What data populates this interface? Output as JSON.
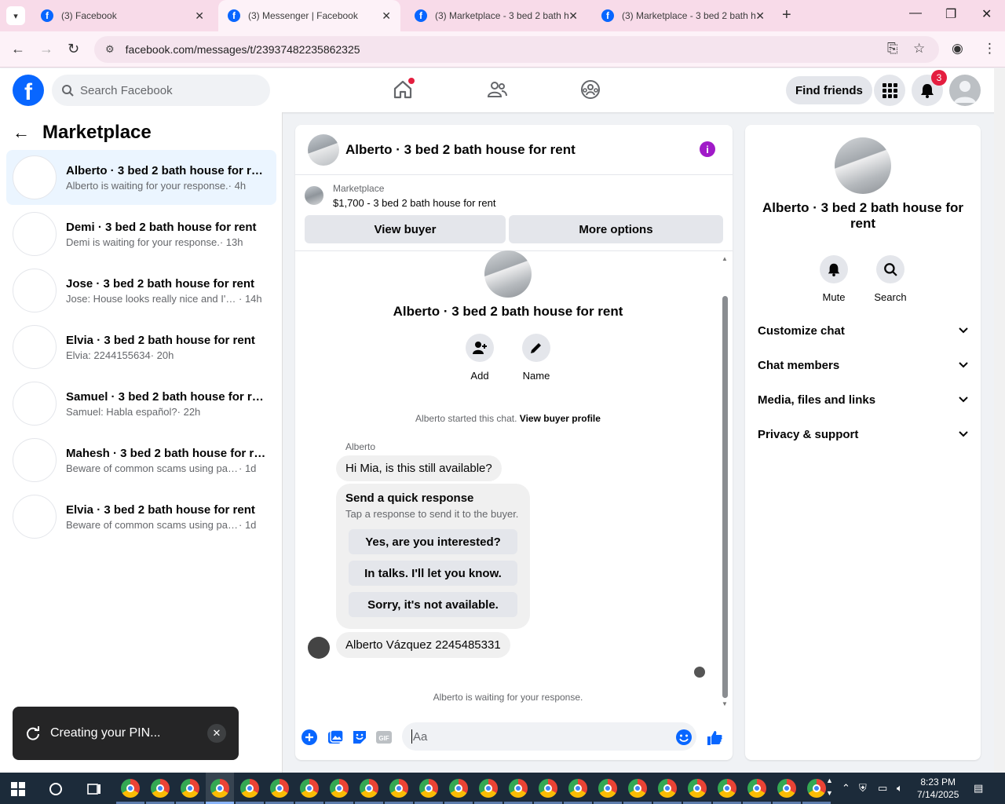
{
  "browser": {
    "tabs": [
      {
        "title": "(3) Facebook",
        "active": false
      },
      {
        "title": "(3) Messenger | Facebook",
        "active": true
      },
      {
        "title": "(3) Marketplace - 3 bed 2 bath h",
        "active": false
      },
      {
        "title": "(3) Marketplace - 3 bed 2 bath h",
        "active": false
      }
    ],
    "url": "facebook.com/messages/t/23937482235862325"
  },
  "fb": {
    "search_placeholder": "Search Facebook",
    "find_friends": "Find friends",
    "notification_count": "3"
  },
  "left": {
    "title": "Marketplace",
    "conversations": [
      {
        "name": "Alberto · 3 bed 2 bath house for rent",
        "preview": "Alberto is waiting for your response.",
        "time": "· 4h",
        "selected": true
      },
      {
        "name": "Demi · 3 bed 2 bath house for rent",
        "preview": "Demi is waiting for your response.",
        "time": "· 13h"
      },
      {
        "name": "Jose · 3 bed 2 bath house for rent",
        "preview": "Jose: House looks really nice and I'm...",
        "time": "· 14h"
      },
      {
        "name": "Elvia · 3 bed 2 bath house for rent",
        "preview": "Elvia: 2244155634",
        "time": "· 20h"
      },
      {
        "name": "Samuel · 3 bed 2 bath house for rent",
        "preview": "Samuel: Habla español?",
        "time": "· 22h"
      },
      {
        "name": "Mahesh · 3 bed 2 bath house for rent",
        "preview": "Beware of common scams using pay...",
        "time": "· 1d"
      },
      {
        "name": "Elvia · 3 bed 2 bath house for rent",
        "preview": "Beware of common scams using pay...",
        "time": "· 1d"
      }
    ],
    "toast": "Creating your PIN..."
  },
  "chat": {
    "title": "Alberto · 3 bed 2 bath house for rent",
    "marketplace_label": "Marketplace",
    "listing": "$1,700 - 3 bed 2 bath house for rent",
    "view_buyer": "View buyer",
    "more_options": "More options",
    "center_title": "Alberto · 3 bed 2 bath house for rent",
    "add_label": "Add",
    "name_label": "Name",
    "started_text": "Alberto started this chat.",
    "view_buyer_profile": "View buyer profile",
    "sender": "Alberto",
    "message1": "Hi Mia, is this still available?",
    "quick_title": "Send a quick response",
    "quick_sub": "Tap a response to send it to the buyer.",
    "quick_options": [
      "Yes, are you interested?",
      "In talks. I'll let you know.",
      "Sorry, it's not available."
    ],
    "message2": "Alberto Vázquez 2245485331",
    "waiting": "Alberto is waiting for your response.",
    "composer_placeholder": "Aa"
  },
  "right": {
    "title": "Alberto · 3 bed 2 bath house for rent",
    "mute": "Mute",
    "search": "Search",
    "sections": [
      "Customize chat",
      "Chat members",
      "Media, files and links",
      "Privacy & support"
    ]
  },
  "taskbar": {
    "time": "8:23 PM",
    "date": "7/14/2025"
  },
  "colors": {
    "fb_blue": "#0866ff",
    "selected_bg": "#ebf5ff",
    "info_purple": "#a01ac8",
    "notif_red": "#e41e3f"
  }
}
